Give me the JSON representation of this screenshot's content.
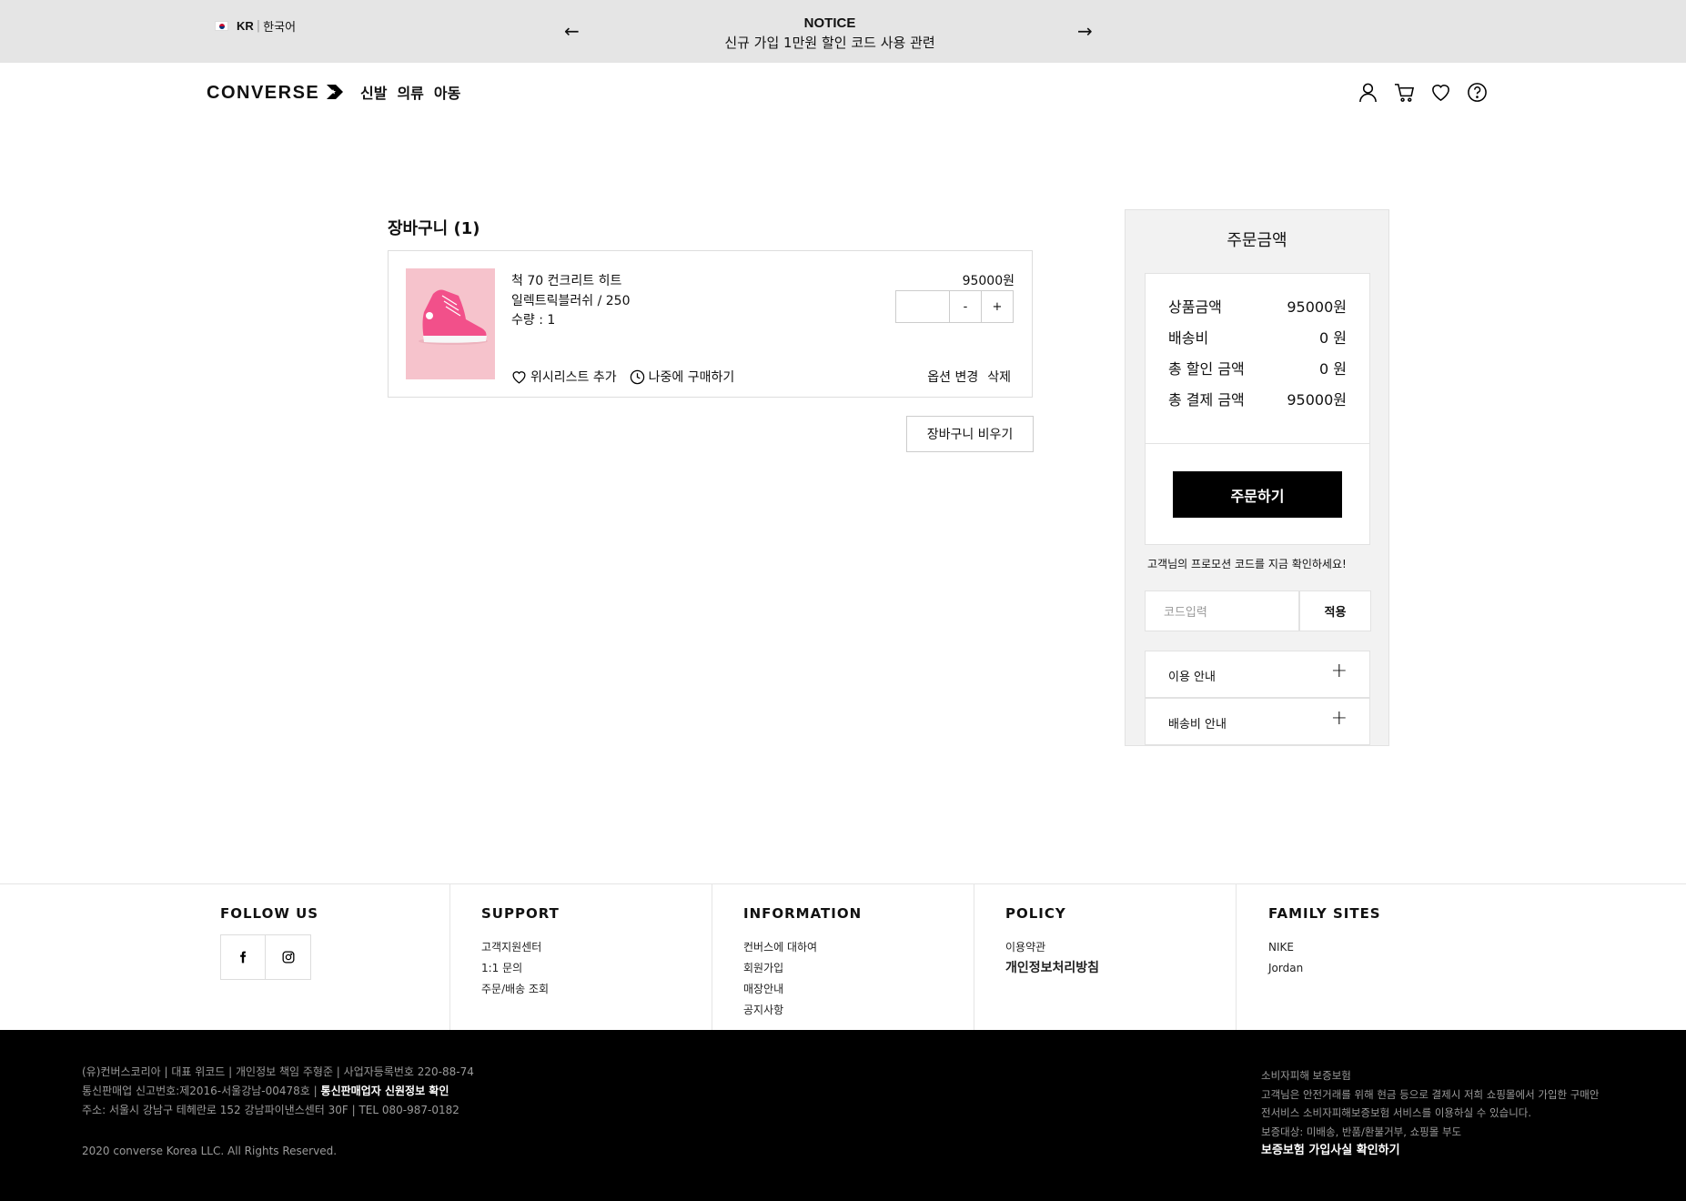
{
  "notice_bar": {
    "locale_code": "KR",
    "locale_separator": "|",
    "locale_language": "한국어",
    "notice_title": "NOTICE",
    "notice_text": "신규 가입 1만원 할인 코드 사용 관련",
    "prev_arrow": "←",
    "next_arrow": "→"
  },
  "header": {
    "logo": "CONVERSE",
    "nav": [
      "신발",
      "의류",
      "아동"
    ],
    "icons": [
      "user-icon",
      "cart-icon",
      "heart-icon",
      "help-icon"
    ]
  },
  "cart": {
    "title": "장바구니 (1)",
    "item": {
      "name": "척 70 컨크리트 히트",
      "option": "일렉트릭블러쉬 / 250",
      "quantity_label": "수량 : 1",
      "price": "95000원",
      "stepper_minus": "-",
      "stepper_plus": "+",
      "wishlist_label": "위시리스트 추가",
      "later_label": "나중에 구매하기",
      "change_option": "옵션 변경",
      "delete": "삭제"
    },
    "empty_button": "장바구니 비우기"
  },
  "summary": {
    "title": "주문금액",
    "rows": [
      {
        "label": "상품금액",
        "value": "95000원"
      },
      {
        "label": "배송비",
        "value": "0 원"
      },
      {
        "label": "총 할인 금액",
        "value": "0 원"
      },
      {
        "label": "총 결제 금액",
        "value": "95000원"
      }
    ],
    "order_button": "주문하기",
    "promo_text": "고객님의 프로모션 코드를 지금 확인하세요!",
    "promo_placeholder": "코드입력",
    "promo_apply": "적용",
    "accordion": [
      "이용 안내",
      "배송비 안내"
    ],
    "accordion_icon": "+"
  },
  "footer": {
    "follow_us": "FOLLOW US",
    "support": {
      "title": "SUPPORT",
      "links": [
        "고객지원센터",
        "1:1 문의",
        "주문/배송 조회"
      ]
    },
    "information": {
      "title": "INFORMATION",
      "links": [
        "컨버스에 대하여",
        "회원가입",
        "매장안내",
        "공지사항"
      ]
    },
    "policy": {
      "title": "POLICY",
      "links": [
        "이용약관",
        "개인정보처리방침"
      ]
    },
    "family": {
      "title": "FAMILY SITES",
      "links": [
        "NIKE",
        "Jordan"
      ]
    },
    "company_line1": "(유)컨버스코리아 | 대표 위코드 | 개인정보 책임 주형준 | 사업자등록번호 220-88-74",
    "company_line2": "통신판매업 신고번호:제2016-서울강남-00478호 |",
    "company_link": "통신판매업자 신원정보 확인",
    "company_line3": "주소: 서울시 강남구 테헤란로 152 강남파이낸스센터 30F | TEL 080-987-0182",
    "copyright": "2020 converse Korea LLC. All Rights Reserved.",
    "insurance_title": "소비자피해 보증보험",
    "insurance_line1": "고객님은 안전거래를 위해 현금 등으로 결제시 저희 쇼핑몰에서 가입한 구매안",
    "insurance_line2": "전서비스 소비자피해보증보험 서비스를 이용하실 수 있습니다.",
    "insurance_line3": "보증대상: 미배송, 반품/환불거부, 쇼핑몰 부도",
    "insurance_link": "보증보험 가입사실 확인하기"
  }
}
